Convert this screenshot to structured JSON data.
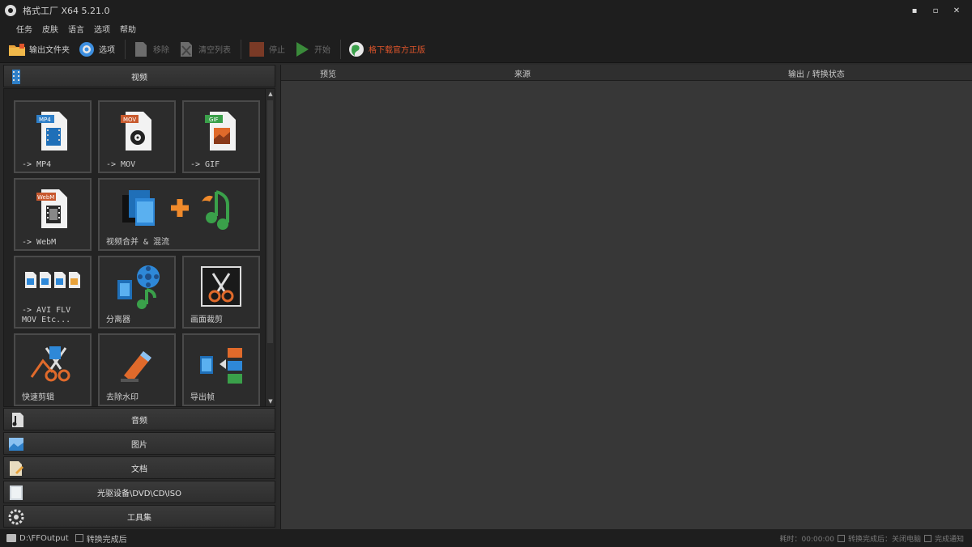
{
  "window": {
    "title": "格式工厂 X64 5.21.0",
    "controls": {
      "minimize": "▪",
      "maximize": "▫",
      "close": "✕"
    }
  },
  "menu": [
    "任务",
    "皮肤",
    "语言",
    "选项",
    "帮助"
  ],
  "toolbar": {
    "output_folder": "输出文件夹",
    "options": "选项",
    "remove": "移除",
    "clear_list": "清空列表",
    "stop": "停止",
    "start": "开始",
    "download_promo": "格下载官方正版"
  },
  "categories": {
    "video": "视频",
    "audio": "音频",
    "picture": "图片",
    "document": "文档",
    "disc": "光驱设备\\DVD\\CD\\ISO",
    "toolbox": "工具集"
  },
  "tiles": [
    {
      "label": "-> MP4",
      "badge": "MP4"
    },
    {
      "label": "-> MOV",
      "badge": "MOV"
    },
    {
      "label": "-> GIF",
      "badge": "GIF"
    },
    {
      "label": "-> WebM",
      "badge": "WebM"
    },
    {
      "label": "视频合并 & 混流"
    },
    {
      "label": "-> AVI FLV\nMOV Etc..."
    },
    {
      "label": "分离器"
    },
    {
      "label": "画面裁剪"
    },
    {
      "label": "快速剪辑"
    },
    {
      "label": "去除水印"
    },
    {
      "label": "导出帧"
    }
  ],
  "columns": {
    "preview": "预览",
    "source": "来源",
    "output_status": "输出 / 转换状态"
  },
  "status": {
    "output_path": "D:\\FFOutput",
    "after_convert": "转换完成后",
    "right_labels": [
      "耗时：00:00:00",
      "转换完成后：关闭电脑",
      "完成通知"
    ]
  },
  "colors": {
    "accent": "#e0552b",
    "panel_bg": "#373737",
    "chrome_bg": "#1e1e1e"
  }
}
